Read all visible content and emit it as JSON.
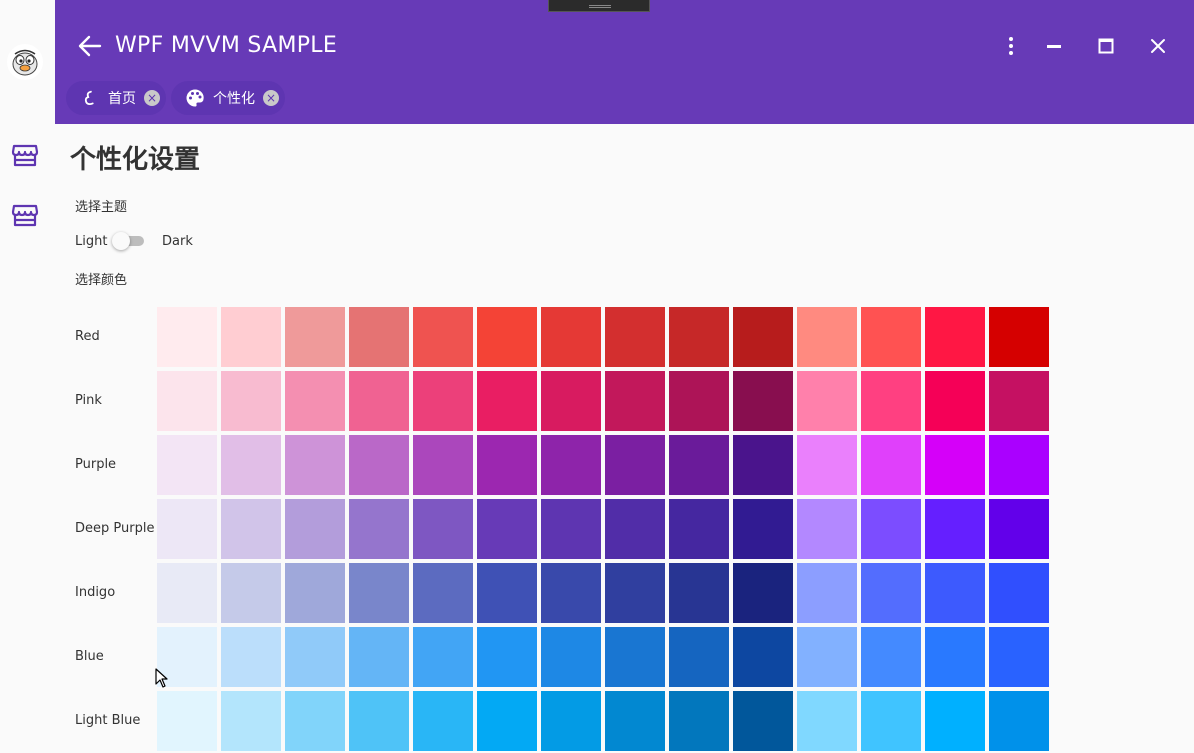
{
  "app": {
    "title": "WPF MVVM SAMPLE"
  },
  "window_controls": {
    "more": "more-vert-icon",
    "minimize": "minimize-icon",
    "maximize": "maximize-icon",
    "close": "close-icon"
  },
  "tabs": [
    {
      "label": "首页",
      "icon": "home-icon",
      "close": "×"
    },
    {
      "label": "个性化",
      "icon": "palette-icon",
      "close": "×"
    }
  ],
  "sidebar": {
    "items": [
      {
        "icon": "store-icon"
      },
      {
        "icon": "store-icon"
      }
    ]
  },
  "page": {
    "title": "个性化设置",
    "theme_section": "选择主题",
    "theme_light": "Light",
    "theme_dark": "Dark",
    "theme_is_dark": false,
    "color_section": "选择颜色"
  },
  "palette": [
    {
      "name": "Red",
      "colors": [
        "#ffebee",
        "#ffcdd2",
        "#ef9a9a",
        "#e57373",
        "#ef5350",
        "#f44336",
        "#e53935",
        "#d32f2f",
        "#c62828",
        "#b71c1c",
        "#ff8a80",
        "#ff5252",
        "#ff1744",
        "#d50000"
      ]
    },
    {
      "name": "Pink",
      "colors": [
        "#fce4ec",
        "#f8bbd0",
        "#f48fb1",
        "#f06292",
        "#ec407a",
        "#e91e63",
        "#d81b60",
        "#c2185b",
        "#ad1457",
        "#880e4f",
        "#ff80ab",
        "#ff4081",
        "#f50057",
        "#c51162"
      ]
    },
    {
      "name": "Purple",
      "colors": [
        "#f3e5f5",
        "#e1bee7",
        "#ce93d8",
        "#ba68c8",
        "#ab47bc",
        "#9c27b0",
        "#8e24aa",
        "#7b1fa2",
        "#6a1b9a",
        "#4a148c",
        "#ea80fc",
        "#e040fb",
        "#d500f9",
        "#aa00ff"
      ]
    },
    {
      "name": "Deep Purple",
      "colors": [
        "#ede7f6",
        "#d1c4e9",
        "#b39ddb",
        "#9575cd",
        "#7e57c2",
        "#673ab7",
        "#5e35b1",
        "#512da8",
        "#4527a0",
        "#311b92",
        "#b388ff",
        "#7c4dff",
        "#651fff",
        "#6200ea"
      ]
    },
    {
      "name": "Indigo",
      "colors": [
        "#e8eaf6",
        "#c5cae9",
        "#9fa8da",
        "#7986cb",
        "#5c6bc0",
        "#3f51b5",
        "#3949ab",
        "#303f9f",
        "#283593",
        "#1a237e",
        "#8c9eff",
        "#536dfe",
        "#3d5afe",
        "#304ffe"
      ]
    },
    {
      "name": "Blue",
      "colors": [
        "#e3f2fd",
        "#bbdefb",
        "#90caf9",
        "#64b5f6",
        "#42a5f5",
        "#2196f3",
        "#1e88e5",
        "#1976d2",
        "#1565c0",
        "#0d47a1",
        "#82b1ff",
        "#448aff",
        "#2979ff",
        "#2962ff"
      ]
    },
    {
      "name": "Light Blue",
      "colors": [
        "#e1f5fe",
        "#b3e5fc",
        "#81d4fa",
        "#4fc3f7",
        "#29b6f6",
        "#03a9f4",
        "#039be5",
        "#0288d1",
        "#0277bd",
        "#01579b",
        "#80d8ff",
        "#40c4ff",
        "#00b0ff",
        "#0091ea"
      ]
    }
  ],
  "colors": {
    "primary": "#673ab7",
    "tab_bg": "#5e35b1",
    "page_bg": "#fafafa"
  }
}
